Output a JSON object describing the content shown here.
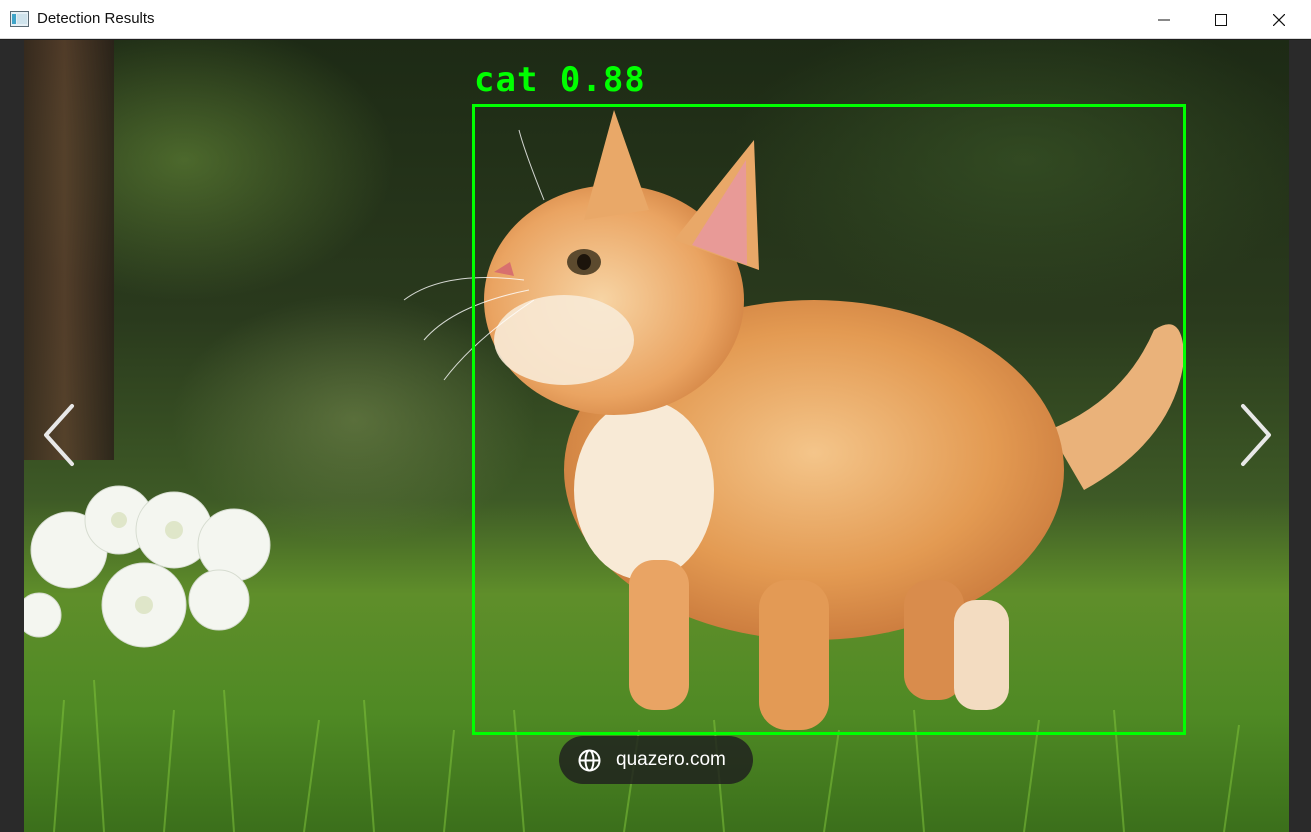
{
  "window": {
    "title": "Detection Results"
  },
  "detection": {
    "label": "cat 0.88",
    "class": "cat",
    "confidence": 0.88,
    "box_color": "#00ff00"
  },
  "watermark": {
    "text": "quazero.com"
  },
  "icons": {
    "app": "app-window-icon",
    "minimize": "minimize-icon",
    "maximize": "maximize-icon",
    "close": "close-icon",
    "prev": "chevron-left-icon",
    "next": "chevron-right-icon",
    "globe": "globe-icon"
  }
}
